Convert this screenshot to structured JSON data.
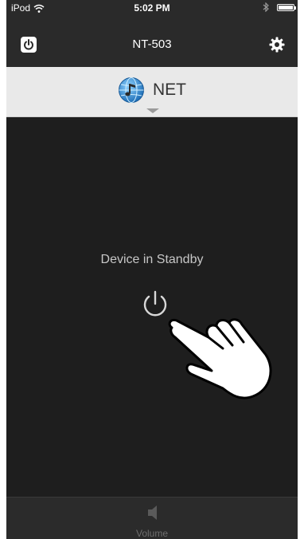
{
  "status_bar": {
    "carrier": "iPod",
    "time": "5:02 PM"
  },
  "nav": {
    "title": "NT-503",
    "left_icon": "power-icon",
    "right_icon": "gear-icon"
  },
  "source": {
    "label": "NET",
    "icon": "globe-music-icon"
  },
  "main": {
    "standby_text": "Device in Standby",
    "power_icon": "power-icon"
  },
  "bottom": {
    "volume_label": "Volume",
    "volume_icon": "speaker-icon"
  },
  "colors": {
    "background": "#1e1e1e",
    "bar": "#2a2a2a",
    "source_bar": "#e9e9e9",
    "text_light": "#c7c7c7",
    "accent_blue": "#2f8fd6"
  }
}
